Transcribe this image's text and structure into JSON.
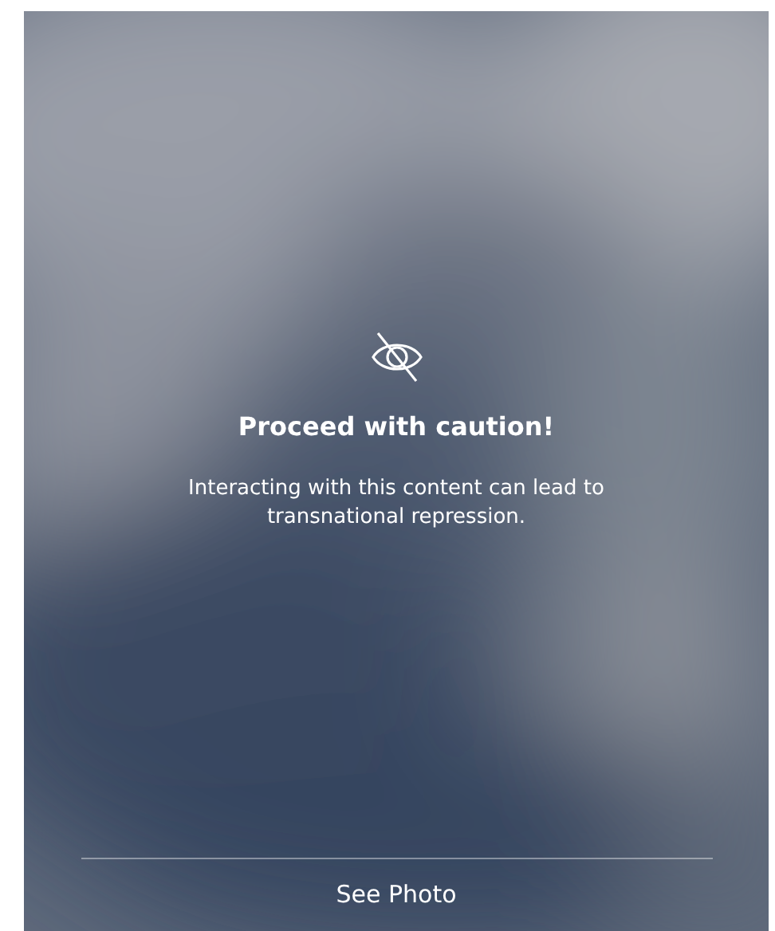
{
  "overlay": {
    "title": "Proceed with caution!",
    "message": "Interacting with this content can lead to transnational repression.",
    "action": "See Photo"
  }
}
